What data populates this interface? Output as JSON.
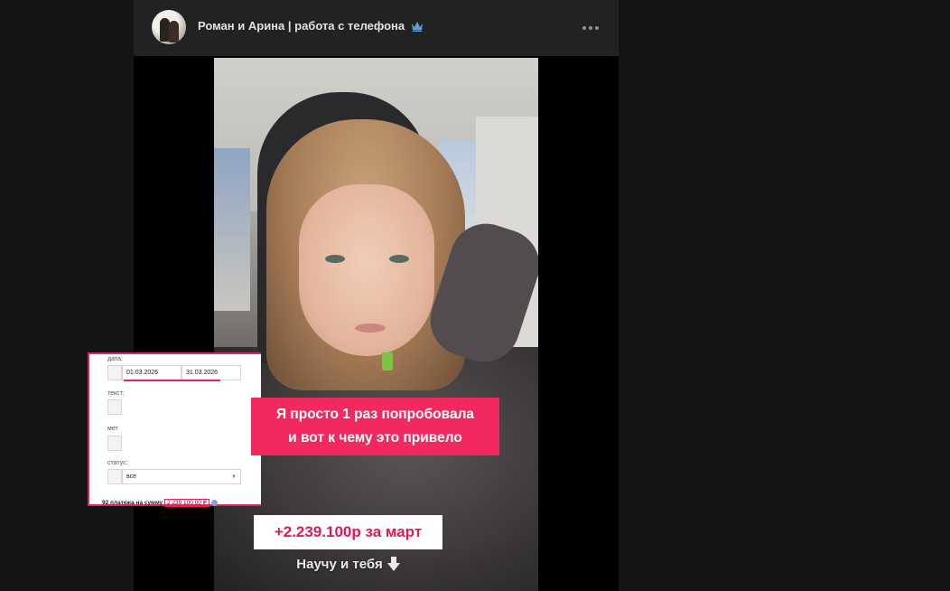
{
  "post": {
    "author": "Роман и Арина | работа с телефона",
    "badge_icon": "crown-icon",
    "menu_icon": "more-horizontal-icon"
  },
  "video_overlay": {
    "screenshot": {
      "date_label": "дата:",
      "date_from": "01.03.2026",
      "date_to": "31.03.2026",
      "text_label": "текст:",
      "method_label": "мет",
      "status_label": "статус:",
      "status_value": "все",
      "summary_prefix": "92 платежа на сумму",
      "summary_total": "2 239 100.00 ₽"
    },
    "banner_line1": "Я просто 1 раз попробовала",
    "banner_line2": "и вот к чему это привело",
    "amount_text": "+2.239.100р за март",
    "teach_text": "Научу и тебя",
    "accent_color": "#f2295f"
  }
}
